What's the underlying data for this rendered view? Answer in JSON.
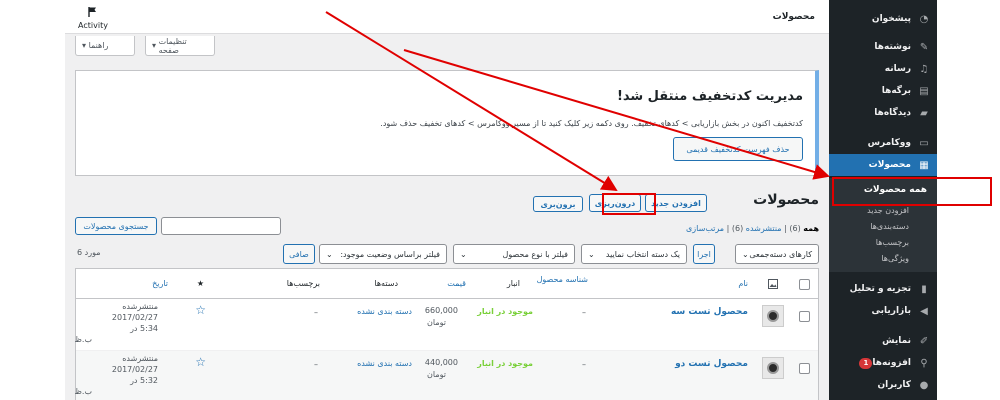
{
  "topbar": {
    "title": "محصولات",
    "activity_label": "Activity"
  },
  "screen_options": {
    "screen_label": "تنظیمات صفحه",
    "help_label": "راهنما"
  },
  "sidebar": {
    "items": [
      {
        "label": "پیشخوان",
        "icon": "dashboard-icon"
      },
      {
        "label": "نوشته‌ها",
        "icon": "pin-icon"
      },
      {
        "label": "رسانه",
        "icon": "media-icon"
      },
      {
        "label": "برگه‌ها",
        "icon": "page-icon"
      },
      {
        "label": "دیدگاه‌ها",
        "icon": "comment-icon"
      },
      {
        "label": "ووکامرس",
        "icon": "woo-icon"
      },
      {
        "label": "محصولات",
        "icon": "archive-icon"
      },
      {
        "label": "تجزیه و تحلیل",
        "icon": "chart-icon"
      },
      {
        "label": "بازاریابی",
        "icon": "megaphone-icon"
      },
      {
        "label": "نمایش",
        "icon": "brush-icon"
      },
      {
        "label": "افزونه‌ها",
        "icon": "plugin-icon",
        "badge": "1"
      },
      {
        "label": "کاربران",
        "icon": "user-icon"
      }
    ],
    "submenu": [
      "همه محصولات",
      "افزودن جدید",
      "دسته‌بندی‌ها",
      "برچسب‌ها",
      "ویژگی‌ها"
    ]
  },
  "notice": {
    "title": "مدیریت کدتخفیف منتقل شد!",
    "text": "کدتخفیف اکنون در بخش بازاریابی > کدهای تخفیف. روی دکمه زیر کلیک کنید تا از مسیر ووکامرس > کدهای تخفیف حذف شود.",
    "button": "حذف فهرست کدتخفیف قدیمی"
  },
  "heading": {
    "title": "محصولات",
    "add_new": "افزودن جدید",
    "import": "درون‌ریزی",
    "export": "برون‌بری"
  },
  "search": {
    "button": "جستجوی محصولات",
    "value": ""
  },
  "views": {
    "all": "همه",
    "all_count": "(6)",
    "published": "منتشرشده",
    "published_count": "(6)",
    "sort": "مرتب‌سازی",
    "sep": "|"
  },
  "filters": {
    "bulk": "کارهای دسته‌جمعی",
    "apply": "اجرا",
    "category": "یک دسته انتخاب نمایید",
    "type": "فیلتر با نوع محصول",
    "stock": "فیلتر براساس وضعیت موجود:",
    "filter_btn": "صافی",
    "count": "6 مورد"
  },
  "table": {
    "headers": {
      "name": "نام",
      "sku": "شناسه محصول",
      "stock": "انبار",
      "price": "قیمت",
      "categories": "دسته‌ها",
      "tags": "برچسب‌ها",
      "featured": "★",
      "date": "تاریخ"
    },
    "rows": [
      {
        "name": "محصول تست سه",
        "sku": "–",
        "stock": "موجود در انبار",
        "price_value": "660,000",
        "price_unit": "تومان",
        "category": "دسته بندی نشده",
        "tags": "–",
        "status": "منتشرشده",
        "date": "2017/02/27",
        "time": "5:34 در",
        "ampm": "ب.ظ"
      },
      {
        "name": "محصول تست دو",
        "sku": "–",
        "stock": "موجود در انبار",
        "price_value": "440,000",
        "price_unit": "تومان",
        "category": "دسته بندی نشده",
        "tags": "–",
        "status": "منتشرشده",
        "date": "2017/02/27",
        "time": "5:32 در",
        "ampm": "ب.ظ"
      }
    ]
  },
  "colors": {
    "sidebar_bg": "#1d2327",
    "accent": "#2271b1",
    "annotation_red": "#e00000",
    "in_stock": "#7ad03a"
  }
}
